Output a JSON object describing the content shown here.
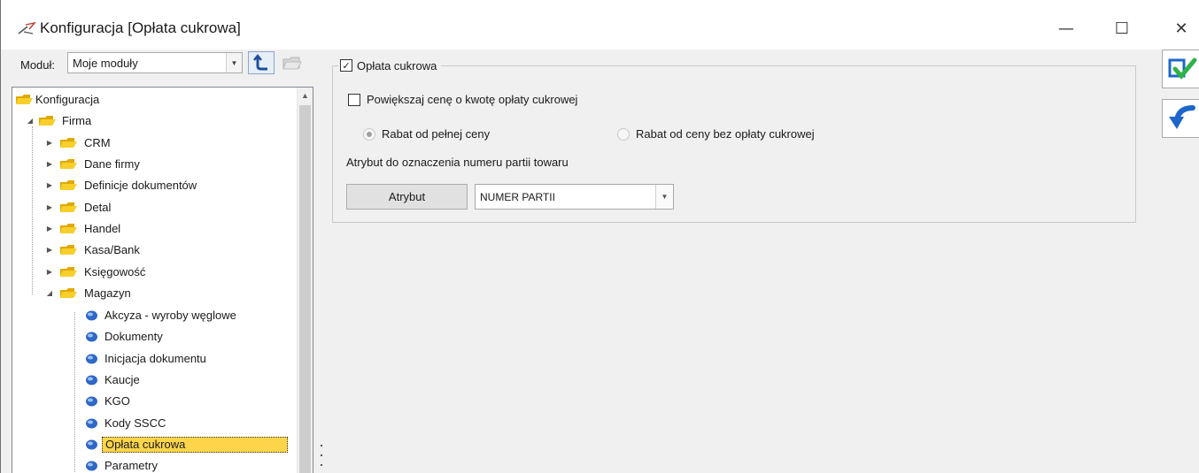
{
  "window": {
    "title": "Konfiguracja [Opłata cukrowa]",
    "minimize_glyph": "—",
    "maximize_glyph": "☐",
    "close_glyph": "✕"
  },
  "module": {
    "label": "Moduł:",
    "selected": "Moje moduły"
  },
  "tree": {
    "items": [
      {
        "label": "Konfiguracja",
        "icon": "folder-icon"
      },
      {
        "label": "Firma",
        "icon": "folder-icon",
        "expanded": true
      },
      {
        "label": "CRM",
        "icon": "folder-icon",
        "expanded": false
      },
      {
        "label": "Dane firmy",
        "icon": "folder-icon",
        "expanded": false
      },
      {
        "label": "Definicje dokumentów",
        "icon": "folder-icon",
        "expanded": false
      },
      {
        "label": "Detal",
        "icon": "folder-icon",
        "expanded": false
      },
      {
        "label": "Handel",
        "icon": "folder-icon",
        "expanded": false
      },
      {
        "label": "Kasa/Bank",
        "icon": "folder-icon",
        "expanded": false
      },
      {
        "label": "Księgowość",
        "icon": "folder-icon",
        "expanded": false
      },
      {
        "label": "Magazyn",
        "icon": "folder-icon",
        "expanded": true
      },
      {
        "label": "Akcyza - wyroby węglowe",
        "icon": "leaf-icon"
      },
      {
        "label": "Dokumenty",
        "icon": "leaf-icon"
      },
      {
        "label": "Inicjacja dokumentu",
        "icon": "leaf-icon"
      },
      {
        "label": "Kaucje",
        "icon": "leaf-icon"
      },
      {
        "label": "KGO",
        "icon": "leaf-icon"
      },
      {
        "label": "Kody SSCC",
        "icon": "leaf-icon"
      },
      {
        "label": "Opłata cukrowa",
        "icon": "leaf-icon",
        "selected": true
      },
      {
        "label": "Parametry",
        "icon": "leaf-icon"
      }
    ]
  },
  "form": {
    "group_title": "Opłata cukrowa",
    "group_checked": true,
    "increase_price_label": "Powiększaj cenę o kwotę opłaty cukrowej",
    "increase_price_checked": false,
    "radio_full_price": "Rabat od pełnej ceny",
    "radio_full_price_selected": true,
    "radio_net_price": "Rabat od ceny bez opłaty cukrowej",
    "radio_net_price_selected": false,
    "attribute_caption": "Atrybut do oznaczenia numeru partii towaru",
    "attribute_button": "Atrybut",
    "attribute_value": "NUMER PARTII"
  },
  "colors": {
    "selection": "#fdd54a",
    "folder": "#f5c518",
    "accent_blue": "#1e66c9"
  }
}
